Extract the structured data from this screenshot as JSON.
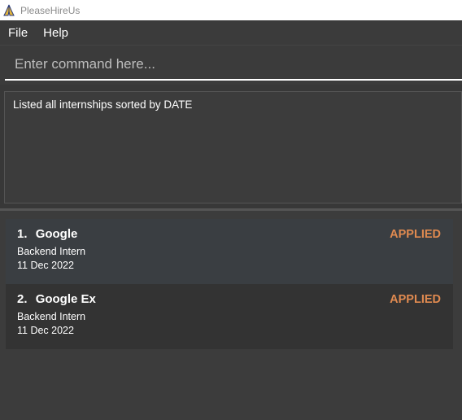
{
  "window": {
    "title": "PleaseHireUs",
    "app_icon": "praying-hands-icon"
  },
  "menubar": {
    "items": [
      {
        "label": "File"
      },
      {
        "label": "Help"
      }
    ]
  },
  "command_box": {
    "placeholder": "Enter command here...",
    "value": ""
  },
  "result_display": {
    "text": "Listed all internships sorted by DATE"
  },
  "internship_list": {
    "items": [
      {
        "index": "1.",
        "company": "Google",
        "role": "Backend Intern",
        "date": "11 Dec 2022",
        "status": "APPLIED"
      },
      {
        "index": "2.",
        "company": "Google Ex",
        "role": "Backend Intern",
        "date": "11 Dec 2022",
        "status": "APPLIED"
      }
    ]
  },
  "colors": {
    "background": "#3b3b3b",
    "status_accent": "#e08a50",
    "text": "#ffffff"
  }
}
